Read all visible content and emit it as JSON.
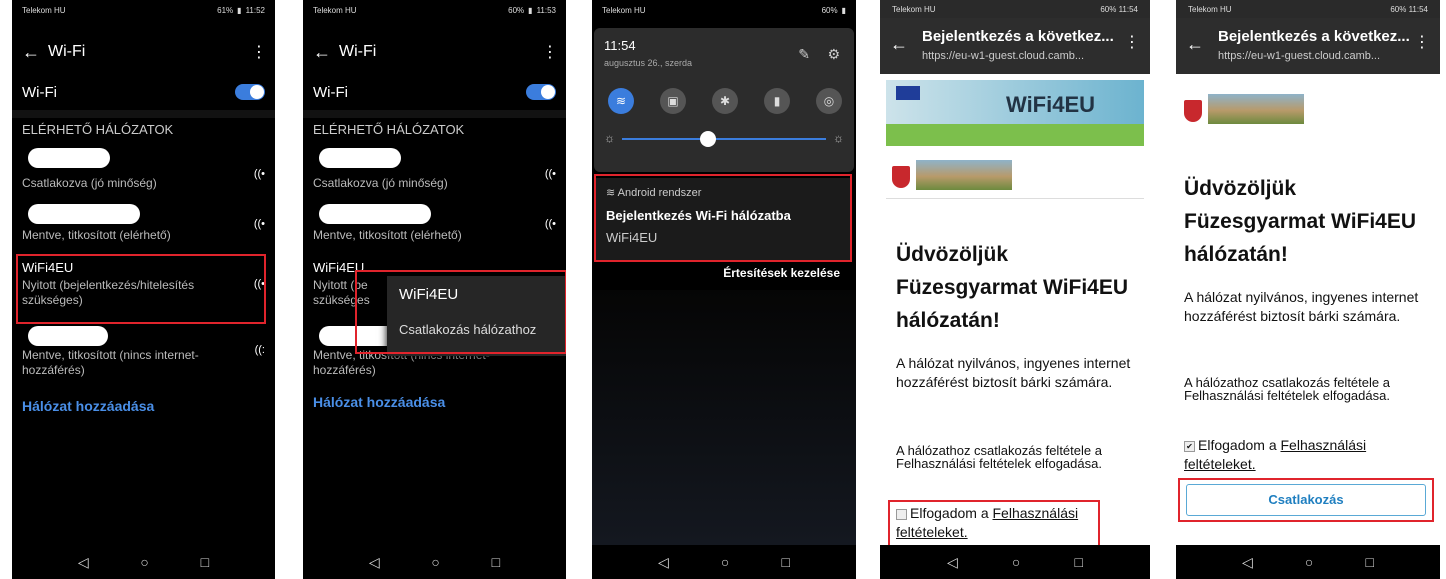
{
  "colors": {
    "accent": "#3b7ddd",
    "highlight": "#e0242c",
    "link": "#4a8fe7"
  },
  "screen1": {
    "status_carrier": "Telekom HU",
    "status_right": "61%",
    "status_time": "11:52",
    "title": "Wi-Fi",
    "wifi_label": "Wi-Fi",
    "section": "ELÉRHETŐ HÁLÓZATOK",
    "networks": [
      {
        "status": "Csatlakozva (jó minőség)"
      },
      {
        "status": "Mentve, titkosított (elérhető)"
      },
      {
        "name": "WiFi4EU",
        "status": "Nyitott (bejelentkezés/hitelesítés szükséges)"
      },
      {
        "status": "Mentve, titkosított (nincs internet-hozzáférés)"
      }
    ],
    "add_network": "Hálózat hozzáadása"
  },
  "screen2": {
    "status_carrier": "Telekom HU",
    "status_right": "60%",
    "status_time": "11:53",
    "title": "Wi-Fi",
    "wifi_label": "Wi-Fi",
    "section": "ELÉRHETŐ HÁLÓZATOK",
    "networks": [
      {
        "status": "Csatlakozva (jó minőség)"
      },
      {
        "status": "Mentve, titkosított (elérhető)"
      },
      {
        "name": "WiFi4EU",
        "status_a": "Nyitott (be",
        "status_b": "szükséges"
      },
      {
        "status": "Mentve, titkosított (nincs internet-hozzáférés)"
      }
    ],
    "popup_title": "WiFi4EU",
    "popup_option": "Csatlakozás hálózathoz",
    "add_network": "Hálózat hozzáadása"
  },
  "screen3": {
    "status_carrier": "Telekom HU",
    "status_right": "60%",
    "time": "11:54",
    "date": "augusztus 26., szerda",
    "notif_source": "Android rendszer",
    "notif_title": "Bejelentkezés Wi-Fi hálózatba",
    "notif_body": "WiFi4EU",
    "manage": "Értesítések kezelése"
  },
  "screen4": {
    "status_carrier": "Telekom HU",
    "status_right": "60%",
    "status_time": "11:54",
    "page_title": "Bejelentkezés a következ...",
    "url": "https://eu-w1-guest.cloud.camb...",
    "banner_logo": "WiFi4EU",
    "welcome": "Üdvözöljük Füzesgyarmat WiFi4EU hálózatán!",
    "para1": "A hálózat nyilvános, ingyenes internet hozzáférést biztosít bárki számára.",
    "para2": "A hálózathoz csatlakozás feltétele a Felhasználási feltételek elfogadása.",
    "accept_prefix": "Elfogadom a ",
    "accept_link_a": "Felhasználási",
    "accept_link_b": "feltételeket."
  },
  "screen5": {
    "status_carrier": "Telekom HU",
    "status_right": "60%",
    "status_time": "11:54",
    "page_title": "Bejelentkezés a következ...",
    "url": "https://eu-w1-guest.cloud.camb...",
    "welcome": "Üdvözöljük Füzesgyarmat WiFi4EU hálózatán!",
    "para1": "A hálózat nyilvános, ingyenes internet hozzáférést biztosít bárki számára.",
    "para2": "A hálózathoz csatlakozás feltétele a Felhasználási feltételek elfogadása.",
    "accept_prefix": "Elfogadom a ",
    "accept_link_a": "Felhasználási",
    "accept_link_b": "feltételeket.",
    "connect": "Csatlakozás"
  }
}
